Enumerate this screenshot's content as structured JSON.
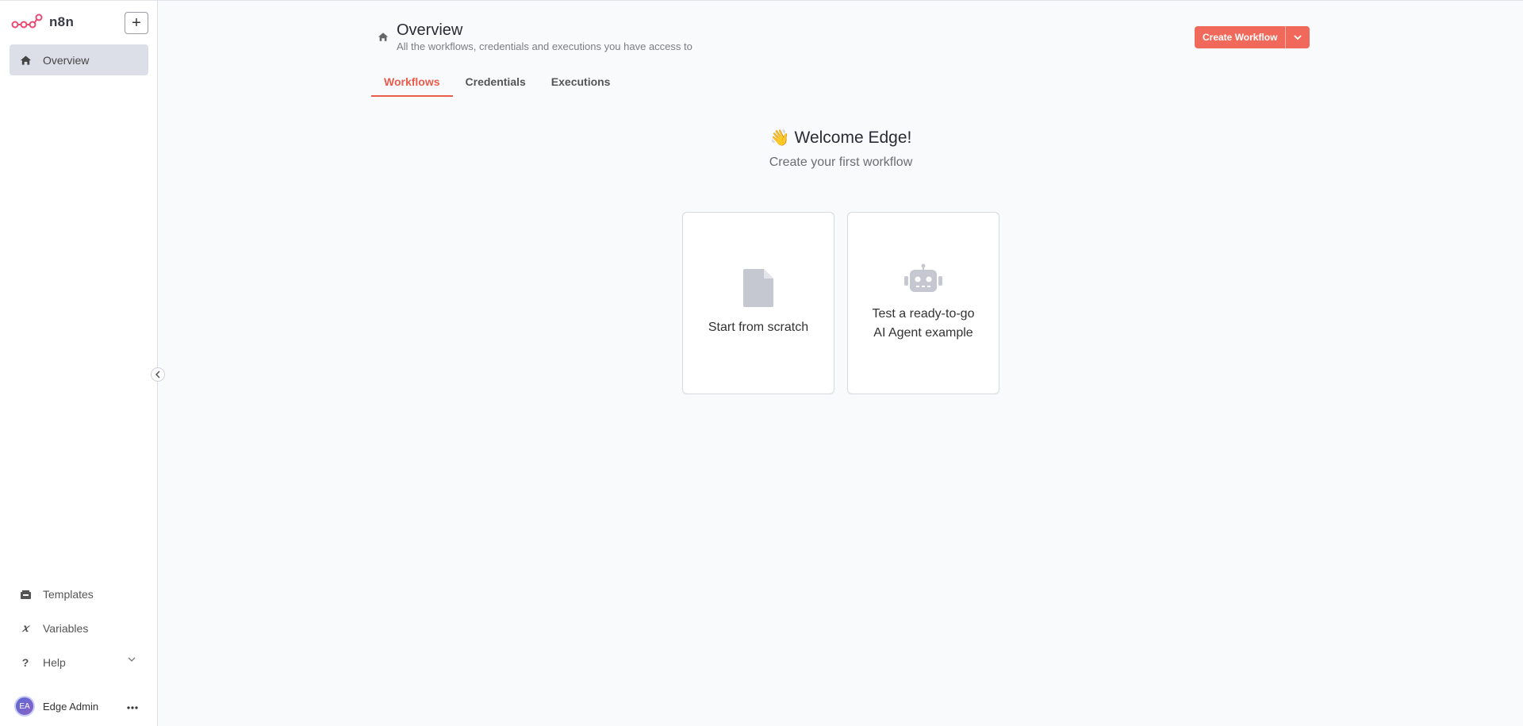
{
  "app": {
    "name": "n8n",
    "brand_color": "#ea4b71"
  },
  "sidebar": {
    "add_label": "+",
    "overview_label": "Overview",
    "templates_label": "Templates",
    "variables_label": "Variables",
    "help_label": "Help",
    "user": {
      "initials": "EA",
      "name": "Edge Admin"
    }
  },
  "header": {
    "title": "Overview",
    "subtitle": "All the workflows, credentials and executions you have access to",
    "create_label": "Create Workflow"
  },
  "tabs": [
    {
      "label": "Workflows",
      "active": true
    },
    {
      "label": "Credentials",
      "active": false
    },
    {
      "label": "Executions",
      "active": false
    }
  ],
  "welcome": {
    "title": "Welcome Edge!",
    "subtitle": "Create your first workflow"
  },
  "cards": {
    "scratch": {
      "label": "Start from scratch"
    },
    "agent": {
      "line1": "Test a ready-to-go",
      "line2": "AI Agent example"
    }
  },
  "colors": {
    "accent": "#ea5c4c",
    "button": "#f0695a"
  }
}
